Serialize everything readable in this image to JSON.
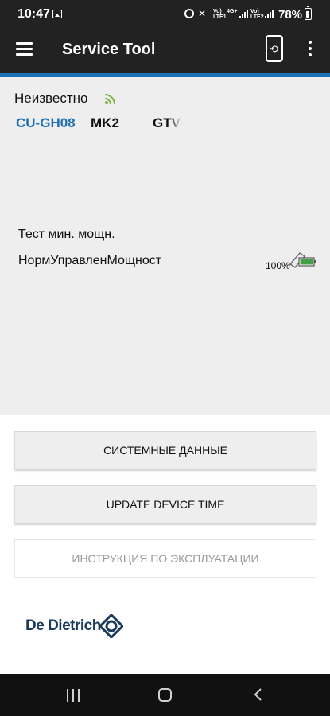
{
  "status_bar": {
    "time": "10:47",
    "sim1": "Vo))\nLTE1",
    "net": "4G+",
    "sim2": "Vo))\nLTE2",
    "battery_pct": "78%"
  },
  "app_bar": {
    "title": "Service Tool",
    "accent_color": "#1a73b9",
    "icons": [
      "menu-icon",
      "sync-device-icon",
      "more-vert-icon"
    ]
  },
  "device": {
    "name": "Неизвестно",
    "signal_icon": "wifi-signal-icon",
    "model": "CU-GH08",
    "version": "MK2",
    "extra": "GTV"
  },
  "test": {
    "label": "Тест мин. мощн.",
    "power_label": "НормУправленМощност",
    "percent": "100%",
    "battery_level": 1.0
  },
  "buttons": {
    "system_data": "СИСТЕМНЫЕ ДАННЫЕ",
    "update_time": "UPDATE DEVICE TIME",
    "manual": "ИНСТРУКЦИЯ ПО ЭКСПЛУАТАЦИИ"
  },
  "logo": {
    "text": "De Dietrich"
  },
  "nav": {
    "icons": [
      "recents-icon",
      "home-icon",
      "back-icon"
    ]
  }
}
